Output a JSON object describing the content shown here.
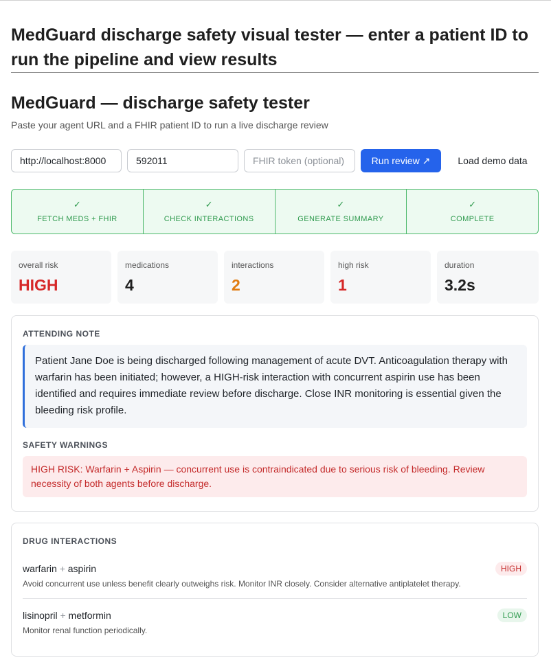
{
  "page": {
    "heading": "MedGuard discharge safety visual tester — enter a patient ID to run the pipeline and view results"
  },
  "app": {
    "title": "MedGuard — discharge safety tester",
    "subtitle": "Paste your agent URL and a FHIR patient ID to run a live discharge review"
  },
  "form": {
    "agent_url_value": "http://localhost:8000",
    "patient_id_value": "592011",
    "token_placeholder": "FHIR token (optional)",
    "run_button": "Run review ↗",
    "demo_button": "Load demo data"
  },
  "pipeline": {
    "steps": [
      {
        "check": "✓",
        "label": "FETCH MEDS + FHIR"
      },
      {
        "check": "✓",
        "label": "CHECK INTERACTIONS"
      },
      {
        "check": "✓",
        "label": "GENERATE SUMMARY"
      },
      {
        "check": "✓",
        "label": "COMPLETE"
      }
    ]
  },
  "stats": [
    {
      "label": "overall risk",
      "value": "HIGH",
      "color": "#d62828"
    },
    {
      "label": "medications",
      "value": "4",
      "color": "#1f1f1f"
    },
    {
      "label": "interactions",
      "value": "2",
      "color": "#e07b10"
    },
    {
      "label": "high risk",
      "value": "1",
      "color": "#d62828"
    },
    {
      "label": "duration",
      "value": "3.2s",
      "color": "#1f1f1f"
    }
  ],
  "summary_card": {
    "note_heading": "ATTENDING NOTE",
    "note_text": "Patient Jane Doe is being discharged following management of acute DVT. Anticoagulation therapy with warfarin has been initiated; however, a HIGH-risk interaction with concurrent aspirin use has been identified and requires immediate review before discharge. Close INR monitoring is essential given the bleeding risk profile.",
    "warnings_heading": "SAFETY WARNINGS",
    "warning_text": "HIGH RISK: Warfarin + Aspirin — concurrent use is contraindicated due to serious risk of bleeding. Review necessity of both agents before discharge."
  },
  "interactions_card": {
    "heading": "DRUG INTERACTIONS",
    "items": [
      {
        "drug_a": "warfarin",
        "plus": "+",
        "drug_b": "aspirin",
        "severity": "HIGH",
        "note": "Avoid concurrent use unless benefit clearly outweighs risk. Monitor INR closely. Consider alternative antiplatelet therapy."
      },
      {
        "drug_a": "lisinopril",
        "plus": "+",
        "drug_b": "metformin",
        "severity": "LOW",
        "note": "Monitor renal function periodically."
      }
    ]
  },
  "colors": {
    "primary": "#2563eb",
    "success": "#2f9a4e",
    "danger": "#c42b2b",
    "warning": "#e07b10"
  }
}
